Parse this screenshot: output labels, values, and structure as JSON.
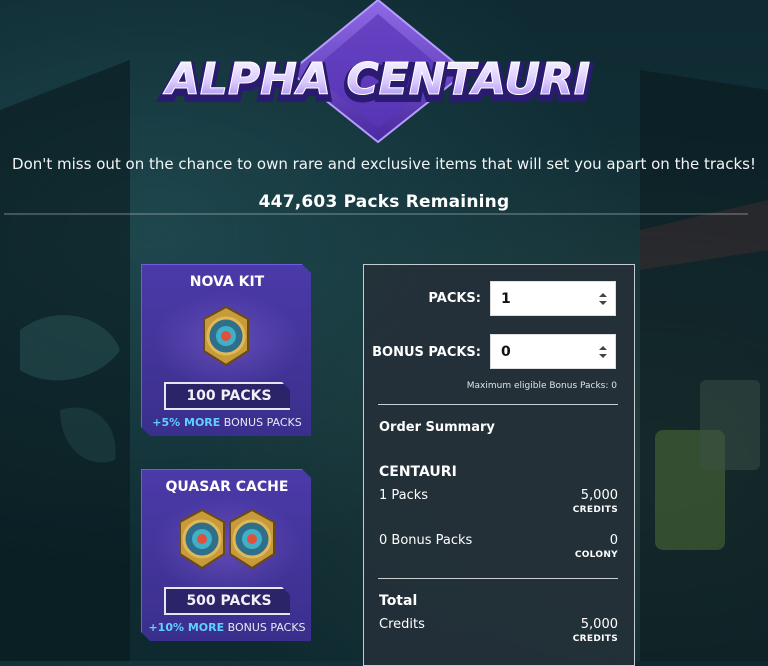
{
  "logo": {
    "text": "ALPHA CENTAURI"
  },
  "tagline": "Don't miss out on the chance to own rare and exclusive items that will set you apart on the tracks!",
  "remaining": {
    "count": "447,603",
    "label": "Packs Remaining"
  },
  "kits": [
    {
      "title": "NOVA KIT",
      "packs": "100 PACKS",
      "bonus_pct": "+5% MORE",
      "bonus_text": "BONUS PACKS"
    },
    {
      "title": "QUASAR CACHE",
      "packs": "500 PACKS",
      "bonus_pct": "+10% MORE",
      "bonus_text": "BONUS PACKS"
    }
  ],
  "form": {
    "packs_label": "PACKS:",
    "packs_value": "1",
    "bonus_label": "BONUS PACKS:",
    "bonus_value": "0",
    "max_note": "Maximum eligible Bonus Packs: 0"
  },
  "summary": {
    "title": "Order Summary",
    "section": "CENTAURI",
    "lines": [
      {
        "label": "1 Packs",
        "value": "5,000",
        "unit": "CREDITS"
      },
      {
        "label": "0 Bonus Packs",
        "value": "0",
        "unit": "COLONY"
      }
    ],
    "total": {
      "heading": "Total",
      "label": "Credits",
      "value": "5,000",
      "unit": "CREDITS"
    }
  },
  "colors": {
    "accent_blue": "#5fd0ff",
    "card_purple": "#3a2f8c",
    "panel_bg": "#243038"
  }
}
